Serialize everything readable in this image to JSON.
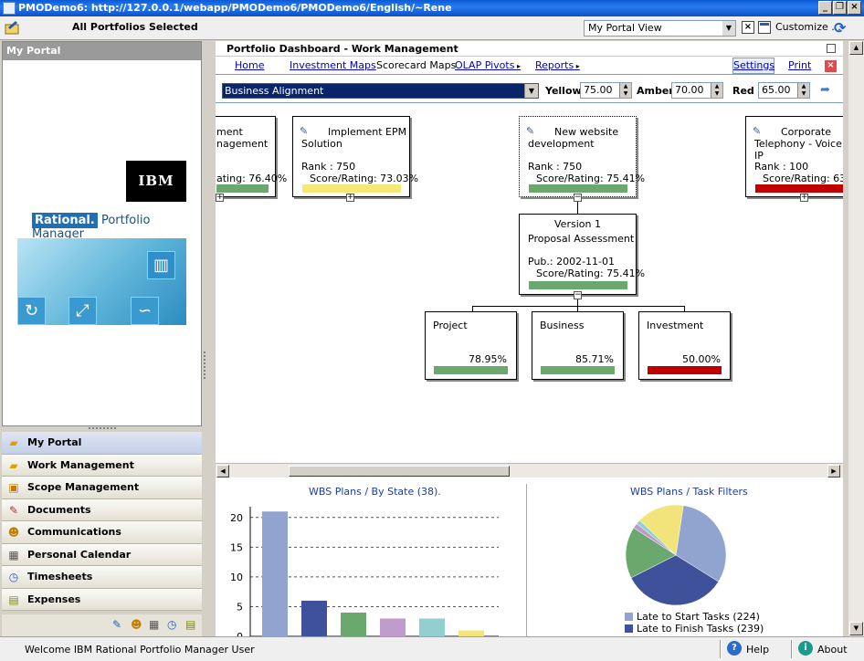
{
  "window": {
    "title": "PMODemo6: http://127.0.0.1/webapp/PMODemo6/PMODemo6/English/~Rene"
  },
  "toolbar": {
    "portfolio_label": "All Portfolios Selected",
    "portal_view": "My Portal View",
    "customize": "Customize ..."
  },
  "left_panel": {
    "title": "My Portal",
    "ibm_logo": "IBM",
    "rational": "Rational.",
    "product": "Portfolio Manager"
  },
  "nav": {
    "items": [
      {
        "label": "My Portal",
        "icon": "folder-icon"
      },
      {
        "label": "Work Management",
        "icon": "folder-icon"
      },
      {
        "label": "Scope Management",
        "icon": "scope-icon"
      },
      {
        "label": "Documents",
        "icon": "documents-icon"
      },
      {
        "label": "Communications",
        "icon": "people-icon"
      },
      {
        "label": "Personal Calendar",
        "icon": "calendar-icon"
      },
      {
        "label": "Timesheets",
        "icon": "clock-icon"
      },
      {
        "label": "Expenses",
        "icon": "money-icon"
      }
    ]
  },
  "panel": {
    "title": "Portfolio Dashboard - Work Management"
  },
  "tabs": {
    "home": "Home",
    "investment_maps": "Investment Maps",
    "scorecard_maps": "Scorecard Maps",
    "olap": "OLAP Pivots",
    "reports": "Reports",
    "settings": "Settings",
    "print": "Print"
  },
  "filter": {
    "select": "Business Alignment",
    "yellow_label": "Yellow",
    "yellow_value": "75.00",
    "amber_label": "Amber",
    "amber_value": "70.00",
    "red_label": "Red",
    "red_value": "65.00"
  },
  "nodes": {
    "n1": {
      "line1": "ment",
      "line2": "nagement",
      "score": "ating: 76.40%"
    },
    "n2": {
      "line1": "Implement EPM",
      "line2": "Solution",
      "rank": "Rank : 750",
      "score": "Score/Rating: 73.03%"
    },
    "n3": {
      "line1": "New website",
      "line2": "development",
      "rank": "Rank : 750",
      "score": "Score/Rating: 75.41%"
    },
    "n4": {
      "line1": "Corporate",
      "line2": "Telephony - Voice ove",
      "line3": "IP",
      "rank": "Rank : 100",
      "score": "Score/Rating: 63.9"
    },
    "version": {
      "line1": "Version 1",
      "line2": "Proposal Assessment",
      "pub": "Pub.: 2002-11-01",
      "score": "Score/Rating: 75.41%"
    },
    "project": {
      "label": "Project",
      "value": "78.95%"
    },
    "business": {
      "label": "Business",
      "value": "85.71%"
    },
    "investment": {
      "label": "Investment",
      "value": "50.00%"
    }
  },
  "charts": {
    "bar_title": "WBS Plans / By State (38).",
    "pie_title": "WBS Plans / Task Filters"
  },
  "chart_data": [
    {
      "type": "bar",
      "title": "WBS Plans / By State (38).",
      "yticks": [
        "0",
        "5",
        "10",
        "15",
        "20"
      ],
      "ylim": [
        0,
        21.5
      ],
      "values": [
        21,
        6,
        4,
        3,
        3,
        1
      ],
      "colors": [
        "#91a3cf",
        "#3f519a",
        "#6aa86d",
        "#c09ccc",
        "#93cfcf",
        "#f2e37a"
      ],
      "grid": true
    },
    {
      "type": "pie",
      "title": "WBS Plans / Task Filters",
      "legend": [
        {
          "label": "Late to Start Tasks (224)",
          "value": 224,
          "color": "#91a3cf"
        },
        {
          "label": "Late to Finish Tasks (239)",
          "value": 239,
          "color": "#3f519a"
        }
      ],
      "slices": [
        {
          "value": 224,
          "color": "#91a3cf"
        },
        {
          "value": 239,
          "color": "#3f519a"
        },
        {
          "value": 118,
          "color": "#6aa86d"
        },
        {
          "value": 12,
          "color": "#c09ccc"
        },
        {
          "value": 10,
          "color": "#93cfcf"
        },
        {
          "value": 108,
          "color": "#f2e37a"
        }
      ]
    }
  ],
  "status": {
    "welcome": "Welcome IBM Rational Portfolio Manager User",
    "help": "Help",
    "about": "About"
  }
}
